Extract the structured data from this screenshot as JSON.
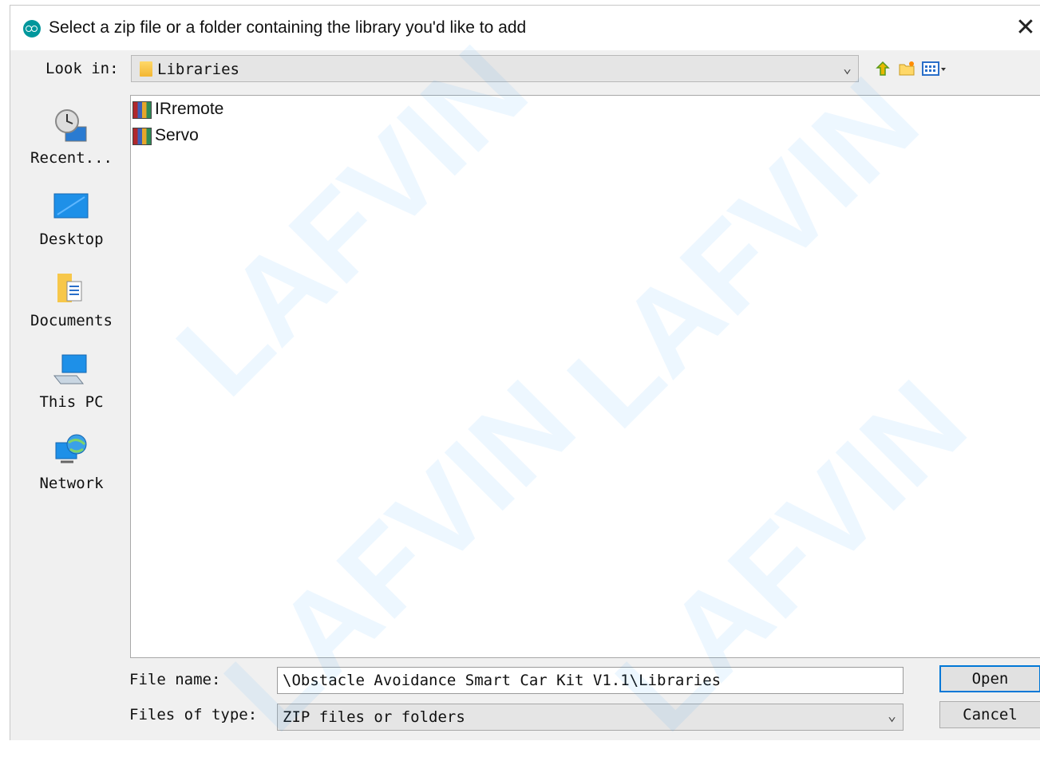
{
  "dialog": {
    "title": "Select a zip file or a folder containing the library you'd like to add",
    "close_glyph": "✕"
  },
  "lookin": {
    "label": "Look in:",
    "value": "Libraries"
  },
  "toolbar": {
    "up_icon": "up-one-level-icon",
    "new_folder_icon": "new-folder-icon",
    "view_icon": "view-menu-icon"
  },
  "places": [
    {
      "label": "Recent...",
      "icon": "recent-items-icon"
    },
    {
      "label": "Desktop",
      "icon": "desktop-icon"
    },
    {
      "label": "Documents",
      "icon": "documents-icon"
    },
    {
      "label": "This PC",
      "icon": "this-pc-icon"
    },
    {
      "label": "Network",
      "icon": "network-icon"
    }
  ],
  "files": [
    {
      "name": "IRremote",
      "icon": "zip-archive-icon"
    },
    {
      "name": "Servo",
      "icon": "zip-archive-icon"
    }
  ],
  "filename": {
    "label": "File name:",
    "value": "\\Obstacle Avoidance Smart Car Kit V1.1\\Libraries"
  },
  "filetype": {
    "label": "Files of type:",
    "value": "ZIP files or folders"
  },
  "buttons": {
    "open": "Open",
    "cancel": "Cancel"
  },
  "watermark": {
    "text": "LAFVIN"
  },
  "colors": {
    "accent": "#0078d7",
    "arduino_teal": "#00979c"
  }
}
